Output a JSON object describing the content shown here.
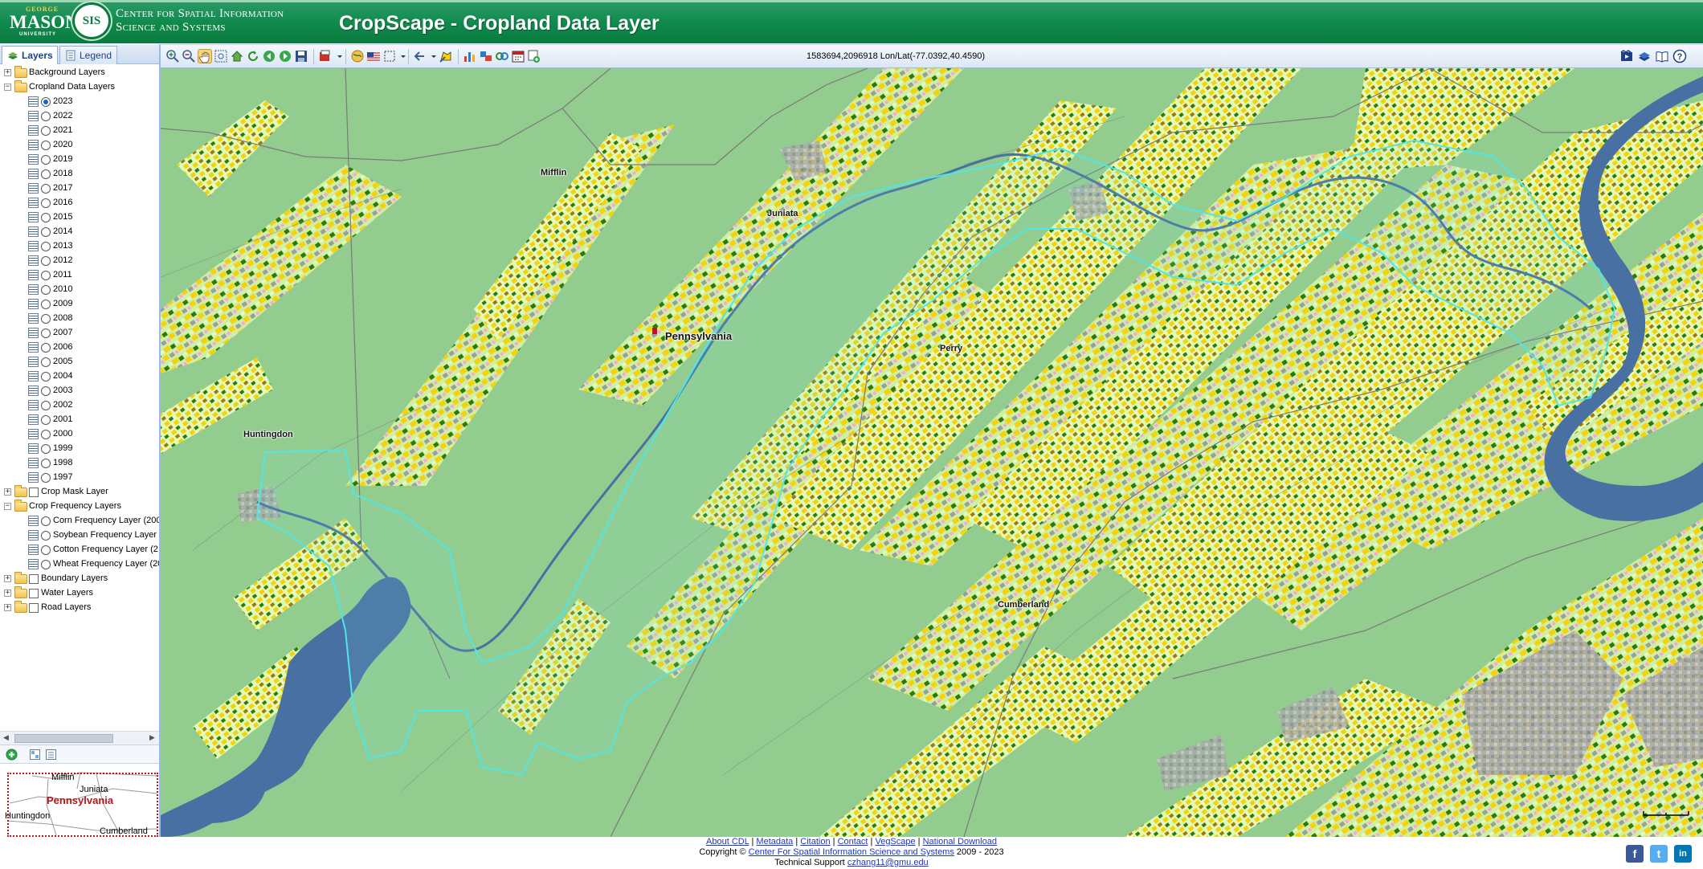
{
  "header": {
    "gmu_top": "GEORGE",
    "gmu_main": "MASON",
    "gmu_bottom": "UNIVERSITY",
    "csiss_badge": "SIS",
    "csiss_line1": "Center for Spatial Information",
    "csiss_line2": "Science and Systems",
    "title": "CropScape - Cropland Data Layer"
  },
  "toolbar": {
    "coordinates": "1583694,2096918 Lon/Lat(-77.0392,40.4590)",
    "tools": [
      "zoom-in-icon",
      "zoom-out-icon",
      "pan-hand-icon",
      "zoom-box-icon",
      "full-extent-icon",
      "refresh-icon",
      "back-arrow-icon",
      "forward-arrow-icon",
      "save-icon",
      "export-icon",
      "globe-icon",
      "us-flag-icon",
      "select-area-icon",
      "navigate-icon",
      "define-aoi-icon",
      "statistics-chart-icon",
      "compare-icon",
      "change-detection-icon",
      "calendar-icon",
      "add-layer-icon",
      "help-video-icon",
      "manual-icon",
      "book-icon",
      "help-icon"
    ]
  },
  "tabs": {
    "layers": "Layers",
    "legend": "Legend"
  },
  "tree": {
    "background": "Background Layers",
    "cdl": "Cropland Data Layers",
    "years": [
      "2023",
      "2022",
      "2021",
      "2020",
      "2019",
      "2018",
      "2017",
      "2016",
      "2015",
      "2014",
      "2013",
      "2012",
      "2011",
      "2010",
      "2009",
      "2008",
      "2007",
      "2006",
      "2005",
      "2004",
      "2003",
      "2002",
      "2001",
      "2000",
      "1999",
      "1998",
      "1997"
    ],
    "selected_year": "2023",
    "crop_mask": "Crop Mask Layer",
    "crop_freq": "Crop Frequency Layers",
    "corn": "Corn Frequency Layer (200",
    "soybean": "Soybean Frequency Layer",
    "cotton": "Cotton Frequency Layer (2",
    "wheat": "Wheat Frequency Layer (20",
    "boundary": "Boundary Layers",
    "water": "Water Layers",
    "road": "Road Layers"
  },
  "overview": {
    "state": "Pennsylvania",
    "counties": [
      "Mifflin",
      "Juniata",
      "Huntingdon",
      "Cumberland"
    ]
  },
  "map": {
    "labels": {
      "mifflin": "Mifflin",
      "juniata": "Juniata",
      "pennsylvania": "Pennsylvania",
      "perry": "Perry",
      "huntingdon": "Huntingdon",
      "cumberland": "Cumberland"
    },
    "colors": {
      "grassland": "#93cc93",
      "forest": "#96cb8c",
      "corn": "#ffd300",
      "soybeans": "#267300",
      "alfalfa": "#ffa5e2",
      "developed": "#9c9c9c",
      "water": "#4970a3",
      "aoi": "#4fe6e6"
    }
  },
  "footer": {
    "about": "About CDL",
    "metadata": "Metadata",
    "citation": "Citation",
    "contact": "Contact",
    "vegscape": "VegScape",
    "download": "National Download",
    "copyright_pre": "Copyright ©",
    "copyright_link": "Center For Spatial Information Science and Systems",
    "copyright_post": "2009 - 2023",
    "support_pre": "Technical Support",
    "support_email": "czhang11@gmu.edu"
  }
}
